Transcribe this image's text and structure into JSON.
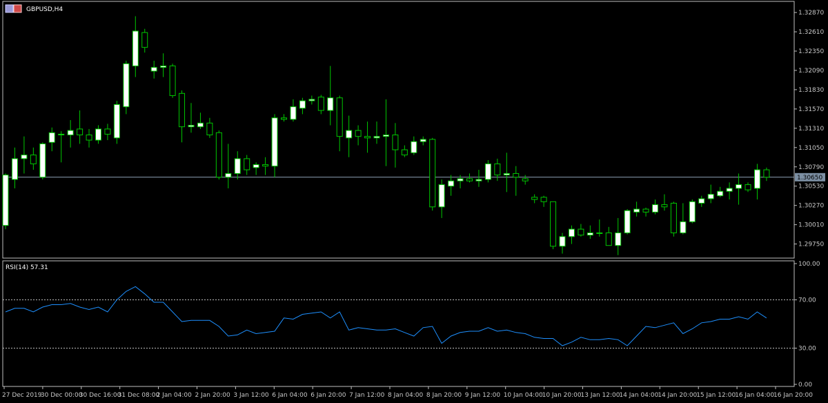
{
  "symbol_title": "GBPUSD,H4",
  "rsi_title": "RSI(14) 57.31",
  "current_price_label": "1.30650",
  "colors": {
    "background": "#000000",
    "frame": "#c0c0c0",
    "bull_body": "#ffffff",
    "bear_body": "#000000",
    "wick": "#00c800",
    "rsi_line": "#1e90ff",
    "rsi_level": "#c0c0c0",
    "current_line": "#8fa3b8",
    "text": "#c8c8c8"
  },
  "chart_data": [
    {
      "type": "candlestick",
      "title": "GBPUSD,H4",
      "ylim": [
        1.2956,
        1.3302
      ],
      "y_ticks": [
        "1.32870",
        "1.32610",
        "1.32350",
        "1.32090",
        "1.31830",
        "1.31570",
        "1.31310",
        "1.31050",
        "1.30790",
        "1.30530",
        "1.30270",
        "1.30010",
        "1.29750"
      ],
      "current_price": 1.3065,
      "x_tick_labels": [
        "27 Dec 2019",
        "30 Dec 00:00",
        "30 Dec 16:00",
        "31 Dec 08:00",
        "2 Jan 04:00",
        "2 Jan 20:00",
        "3 Jan 12:00",
        "6 Jan 04:00",
        "6 Jan 20:00",
        "7 Jan 12:00",
        "8 Jan 04:00",
        "8 Jan 20:00",
        "9 Jan 12:00",
        "10 Jan 04:00",
        "10 Jan 20:00",
        "13 Jan 12:00",
        "14 Jan 04:00",
        "14 Jan 20:00",
        "15 Jan 12:00",
        "16 Jan 04:00",
        "16 Jan 20:00"
      ],
      "candles": [
        {
          "o": 1.3,
          "h": 1.307,
          "l": 1.2995,
          "c": 1.3068
        },
        {
          "o": 1.3062,
          "h": 1.3105,
          "l": 1.305,
          "c": 1.309
        },
        {
          "o": 1.309,
          "h": 1.312,
          "l": 1.307,
          "c": 1.3095
        },
        {
          "o": 1.3095,
          "h": 1.3105,
          "l": 1.3075,
          "c": 1.3083
        },
        {
          "o": 1.3065,
          "h": 1.3112,
          "l": 1.3062,
          "c": 1.311
        },
        {
          "o": 1.3112,
          "h": 1.3132,
          "l": 1.31,
          "c": 1.3125
        },
        {
          "o": 1.3122,
          "h": 1.3127,
          "l": 1.3085,
          "c": 1.3123
        },
        {
          "o": 1.3122,
          "h": 1.3142,
          "l": 1.3105,
          "c": 1.3128
        },
        {
          "o": 1.313,
          "h": 1.3155,
          "l": 1.311,
          "c": 1.3122
        },
        {
          "o": 1.3122,
          "h": 1.313,
          "l": 1.3105,
          "c": 1.3115
        },
        {
          "o": 1.3115,
          "h": 1.3135,
          "l": 1.311,
          "c": 1.313
        },
        {
          "o": 1.313,
          "h": 1.3137,
          "l": 1.3115,
          "c": 1.3123
        },
        {
          "o": 1.3118,
          "h": 1.3168,
          "l": 1.311,
          "c": 1.3163
        },
        {
          "o": 1.316,
          "h": 1.3222,
          "l": 1.315,
          "c": 1.3218
        },
        {
          "o": 1.3215,
          "h": 1.3282,
          "l": 1.32,
          "c": 1.3262
        },
        {
          "o": 1.326,
          "h": 1.3265,
          "l": 1.3233,
          "c": 1.324
        },
        {
          "o": 1.3208,
          "h": 1.3222,
          "l": 1.3198,
          "c": 1.3213
        },
        {
          "o": 1.3213,
          "h": 1.3232,
          "l": 1.32,
          "c": 1.3215
        },
        {
          "o": 1.3215,
          "h": 1.3218,
          "l": 1.3172,
          "c": 1.3175
        },
        {
          "o": 1.3178,
          "h": 1.3182,
          "l": 1.3112,
          "c": 1.3133
        },
        {
          "o": 1.3133,
          "h": 1.3165,
          "l": 1.3125,
          "c": 1.3135
        },
        {
          "o": 1.3133,
          "h": 1.3152,
          "l": 1.313,
          "c": 1.3138
        },
        {
          "o": 1.3138,
          "h": 1.3145,
          "l": 1.3118,
          "c": 1.3122
        },
        {
          "o": 1.3125,
          "h": 1.3128,
          "l": 1.3062,
          "c": 1.3065
        },
        {
          "o": 1.3065,
          "h": 1.311,
          "l": 1.305,
          "c": 1.307
        },
        {
          "o": 1.307,
          "h": 1.31,
          "l": 1.3062,
          "c": 1.309
        },
        {
          "o": 1.309,
          "h": 1.3095,
          "l": 1.3068,
          "c": 1.3075
        },
        {
          "o": 1.3078,
          "h": 1.3085,
          "l": 1.3068,
          "c": 1.3082
        },
        {
          "o": 1.3082,
          "h": 1.3092,
          "l": 1.3068,
          "c": 1.308
        },
        {
          "o": 1.308,
          "h": 1.315,
          "l": 1.3065,
          "c": 1.3145
        },
        {
          "o": 1.3145,
          "h": 1.315,
          "l": 1.314,
          "c": 1.3143
        },
        {
          "o": 1.3143,
          "h": 1.317,
          "l": 1.314,
          "c": 1.316
        },
        {
          "o": 1.3158,
          "h": 1.3172,
          "l": 1.315,
          "c": 1.3168
        },
        {
          "o": 1.3168,
          "h": 1.3175,
          "l": 1.3163,
          "c": 1.317
        },
        {
          "o": 1.3173,
          "h": 1.3176,
          "l": 1.315,
          "c": 1.3155
        },
        {
          "o": 1.3155,
          "h": 1.3215,
          "l": 1.3135,
          "c": 1.3172
        },
        {
          "o": 1.3172,
          "h": 1.3175,
          "l": 1.31,
          "c": 1.312
        },
        {
          "o": 1.3118,
          "h": 1.3148,
          "l": 1.3092,
          "c": 1.3128
        },
        {
          "o": 1.3128,
          "h": 1.3135,
          "l": 1.3108,
          "c": 1.312
        },
        {
          "o": 1.312,
          "h": 1.314,
          "l": 1.3098,
          "c": 1.3118
        },
        {
          "o": 1.3118,
          "h": 1.314,
          "l": 1.311,
          "c": 1.312
        },
        {
          "o": 1.312,
          "h": 1.317,
          "l": 1.308,
          "c": 1.3122
        },
        {
          "o": 1.3122,
          "h": 1.3138,
          "l": 1.3078,
          "c": 1.3102
        },
        {
          "o": 1.3102,
          "h": 1.3108,
          "l": 1.3092,
          "c": 1.3095
        },
        {
          "o": 1.3098,
          "h": 1.312,
          "l": 1.3095,
          "c": 1.3113
        },
        {
          "o": 1.3113,
          "h": 1.312,
          "l": 1.3108,
          "c": 1.3116
        },
        {
          "o": 1.3116,
          "h": 1.3118,
          "l": 1.302,
          "c": 1.3025
        },
        {
          "o": 1.3025,
          "h": 1.3062,
          "l": 1.301,
          "c": 1.3055
        },
        {
          "o": 1.3053,
          "h": 1.3068,
          "l": 1.304,
          "c": 1.306
        },
        {
          "o": 1.306,
          "h": 1.3068,
          "l": 1.305,
          "c": 1.3063
        },
        {
          "o": 1.3063,
          "h": 1.307,
          "l": 1.3058,
          "c": 1.306
        },
        {
          "o": 1.306,
          "h": 1.3075,
          "l": 1.3052,
          "c": 1.3062
        },
        {
          "o": 1.3062,
          "h": 1.3088,
          "l": 1.3058,
          "c": 1.3083
        },
        {
          "o": 1.3083,
          "h": 1.309,
          "l": 1.306,
          "c": 1.3068
        },
        {
          "o": 1.3068,
          "h": 1.3098,
          "l": 1.3045,
          "c": 1.307
        },
        {
          "o": 1.307,
          "h": 1.308,
          "l": 1.304,
          "c": 1.3065
        },
        {
          "o": 1.3063,
          "h": 1.3068,
          "l": 1.3055,
          "c": 1.306
        },
        {
          "o": 1.3038,
          "h": 1.3042,
          "l": 1.303,
          "c": 1.3035
        },
        {
          "o": 1.3038,
          "h": 1.304,
          "l": 1.3025,
          "c": 1.3032
        },
        {
          "o": 1.3032,
          "h": 1.3032,
          "l": 1.2968,
          "c": 1.2972
        },
        {
          "o": 1.2972,
          "h": 1.299,
          "l": 1.2962,
          "c": 1.2985
        },
        {
          "o": 1.2985,
          "h": 1.3,
          "l": 1.2975,
          "c": 1.2995
        },
        {
          "o": 1.2995,
          "h": 1.3002,
          "l": 1.2985,
          "c": 1.2987
        },
        {
          "o": 1.2987,
          "h": 1.3,
          "l": 1.2982,
          "c": 1.299
        },
        {
          "o": 1.299,
          "h": 1.3008,
          "l": 1.2985,
          "c": 1.299
        },
        {
          "o": 1.299,
          "h": 1.2998,
          "l": 1.2975,
          "c": 1.2973
        },
        {
          "o": 1.2973,
          "h": 1.301,
          "l": 1.296,
          "c": 1.299
        },
        {
          "o": 1.299,
          "h": 1.3022,
          "l": 1.2988,
          "c": 1.302
        },
        {
          "o": 1.3018,
          "h": 1.3032,
          "l": 1.3012,
          "c": 1.3022
        },
        {
          "o": 1.3022,
          "h": 1.3024,
          "l": 1.3012,
          "c": 1.3018
        },
        {
          "o": 1.3018,
          "h": 1.3035,
          "l": 1.3015,
          "c": 1.3028
        },
        {
          "o": 1.3028,
          "h": 1.3042,
          "l": 1.302,
          "c": 1.3025
        },
        {
          "o": 1.303,
          "h": 1.3032,
          "l": 1.2985,
          "c": 1.299
        },
        {
          "o": 1.299,
          "h": 1.303,
          "l": 1.2988,
          "c": 1.3005
        },
        {
          "o": 1.3005,
          "h": 1.3035,
          "l": 1.3003,
          "c": 1.3032
        },
        {
          "o": 1.303,
          "h": 1.304,
          "l": 1.3025,
          "c": 1.3036
        },
        {
          "o": 1.3036,
          "h": 1.3055,
          "l": 1.303,
          "c": 1.3042
        },
        {
          "o": 1.304,
          "h": 1.3052,
          "l": 1.3038,
          "c": 1.3046
        },
        {
          "o": 1.3046,
          "h": 1.3058,
          "l": 1.3035,
          "c": 1.305
        },
        {
          "o": 1.305,
          "h": 1.307,
          "l": 1.3028,
          "c": 1.3055
        },
        {
          "o": 1.3055,
          "h": 1.3058,
          "l": 1.3045,
          "c": 1.3048
        },
        {
          "o": 1.305,
          "h": 1.3083,
          "l": 1.3035,
          "c": 1.3075
        },
        {
          "o": 1.3075,
          "h": 1.3078,
          "l": 1.306,
          "c": 1.3065
        }
      ]
    },
    {
      "type": "line",
      "title": "RSI(14) 57.31",
      "ylim": [
        0,
        100
      ],
      "y_ticks": [
        "100.00",
        "70.00",
        "30.00",
        "0.00"
      ],
      "levels": [
        70,
        30
      ],
      "series": [
        {
          "values": [
            60,
            63,
            63,
            60,
            64,
            66,
            66,
            67,
            64,
            62,
            64,
            60,
            70,
            77,
            81,
            75,
            68,
            68,
            60,
            52,
            53,
            53,
            53,
            48,
            40,
            41,
            45,
            42,
            43,
            44,
            55,
            54,
            58,
            59,
            60,
            55,
            60,
            45,
            47,
            46,
            45,
            45,
            46,
            43,
            40,
            47,
            48,
            34,
            40,
            43,
            44,
            44,
            47,
            44,
            45,
            43,
            42,
            39,
            38,
            38,
            32,
            35,
            39,
            37,
            37,
            38,
            37,
            32,
            40,
            48,
            47,
            49,
            51,
            42,
            46,
            51,
            52,
            54,
            54,
            56,
            54,
            60,
            55
          ]
        }
      ]
    }
  ]
}
